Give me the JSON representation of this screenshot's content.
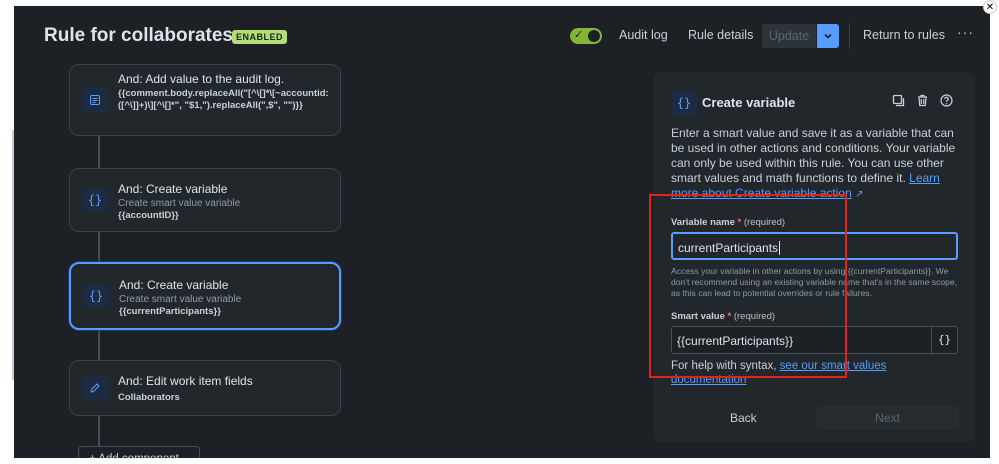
{
  "header": {
    "title": "Rule for collaborates",
    "status_badge": "ENABLED",
    "audit_log": "Audit log",
    "rule_details": "Rule details",
    "update": "Update",
    "return_to_rules": "Return to rules",
    "more": "···"
  },
  "flow": {
    "cards": [
      {
        "title": "And: Add value to the audit log.",
        "subtitle": "",
        "detail": "{{comment.body.replaceAll(\"[^\\[]*\\[~accountid:([^\\]]+)\\][^\\[]*\", \"$1,\").replaceAll(\",$\", \"\")}}",
        "icon": "list-icon"
      },
      {
        "title": "And: Create variable",
        "subtitle": "Create smart value variable",
        "detail": "{{accountID}}",
        "icon": "braces-icon"
      },
      {
        "title": "And: Create variable",
        "subtitle": "Create smart value variable",
        "detail": "{{currentParticipants}}",
        "icon": "braces-icon"
      },
      {
        "title": "And: Edit work item fields",
        "subtitle": "",
        "detail": "Collaborators",
        "icon": "edit-icon"
      }
    ],
    "add_component": "+ Add component"
  },
  "panel": {
    "title": "Create variable",
    "description": "Enter a smart value and save it as a variable that can be used in other actions and conditions. Your variable can only be used within this rule. You can use other smart values and math functions to define it.",
    "learn_more": "Learn more about Create variable action",
    "variable_name_label": "Variable name",
    "required_mark": "*",
    "required_text": "(required)",
    "variable_name_value": "currentParticipants",
    "helper": "Access your variable in other actions by using {{currentParticipants}}. We don't recommend using an existing variable name that's in the same scope, as this can lead to potential overrides or rule failures.",
    "smart_value_label": "Smart value",
    "smart_value_value": "{{currentParticipants}}",
    "syntax_help": "For help with syntax,",
    "syntax_link": "see our smart values documentation",
    "back": "Back",
    "next": "Next"
  },
  "colors": {
    "background": "#1d2125",
    "accent": "#579dff",
    "enabled": "#82b536",
    "highlight_box": "#e2231a"
  }
}
